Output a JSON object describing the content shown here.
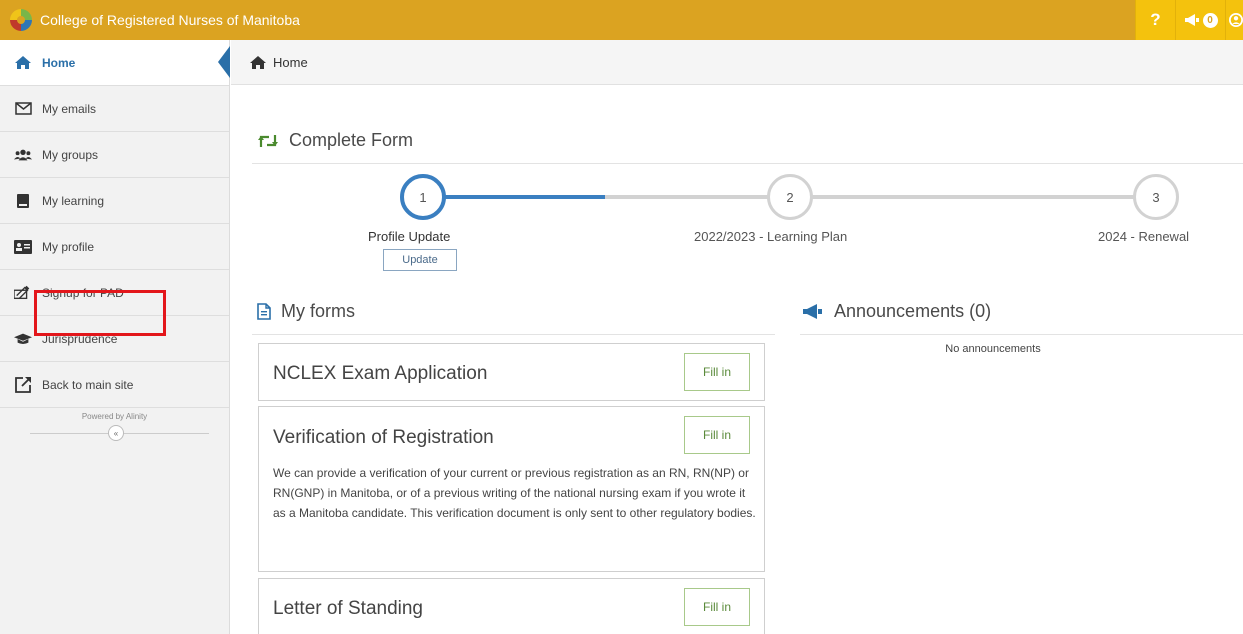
{
  "header": {
    "title": "College of Registered Nurses of Manitoba",
    "help_label": "?",
    "announcements_count": "0"
  },
  "sidebar": {
    "items": [
      {
        "label": "Home",
        "icon": "home-icon"
      },
      {
        "label": "My emails",
        "icon": "envelope-icon"
      },
      {
        "label": "My groups",
        "icon": "users-icon"
      },
      {
        "label": "My learning",
        "icon": "book-icon"
      },
      {
        "label": "My profile",
        "icon": "id-card-icon"
      },
      {
        "label": "Signup for PAD",
        "icon": "signup-icon"
      },
      {
        "label": "Jurisprudence",
        "icon": "graduation-cap-icon"
      },
      {
        "label": "Back to main site",
        "icon": "external-link-icon"
      }
    ],
    "powered_by": "Powered by Alinity",
    "collapse_label": "«"
  },
  "breadcrumb": {
    "label": "Home"
  },
  "complete_form": {
    "title": "Complete Form",
    "steps": [
      {
        "number": "1",
        "label": "Profile Update",
        "state": "current"
      },
      {
        "number": "2",
        "label": "2022/2023 - Learning Plan",
        "state": "pending"
      },
      {
        "number": "3",
        "label": "2024 - Renewal",
        "state": "pending"
      }
    ],
    "progress_fraction": 0.25,
    "update_label": "Update"
  },
  "my_forms": {
    "title": "My forms",
    "fill_label": "Fill in",
    "forms": [
      {
        "title": "NCLEX Exam Application",
        "description": ""
      },
      {
        "title": "Verification of Registration",
        "description": "We can provide a verification of your current or previous registration as an RN, RN(NP) or RN(GNP) in Manitoba, or of a previous writing of the national nursing exam if you wrote it as a Manitoba candidate. This verification document is only sent to other regulatory bodies."
      },
      {
        "title": "Letter of Standing",
        "description": ""
      }
    ]
  },
  "announcements": {
    "title": "Announcements (0)",
    "empty_text": "No announcements"
  },
  "colors": {
    "topbar": "#dba321",
    "accent_blue": "#3a7fc1",
    "fill_green": "#5a8a3a",
    "highlight_red": "#e3161b"
  }
}
